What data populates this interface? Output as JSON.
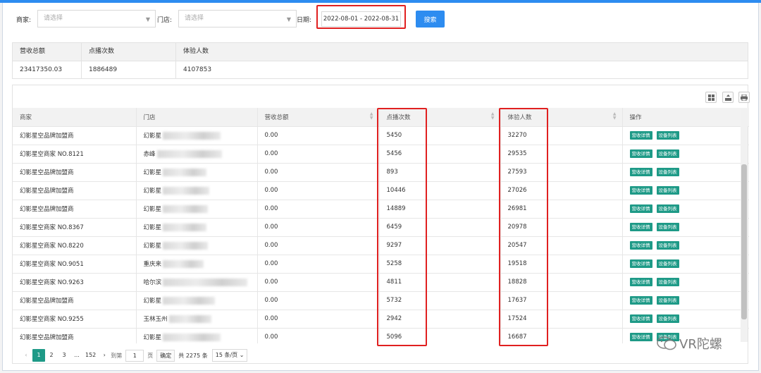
{
  "filters": {
    "merchant_label": "商家:",
    "merchant_placeholder": "请选择",
    "store_label": "门店:",
    "store_placeholder": "请选择",
    "date_label": "日期:",
    "date_value": "2022-08-01 - 2022-08-31",
    "search_label": "搜索"
  },
  "summary": {
    "headers": [
      "营收总额",
      "点播次数",
      "体验人数"
    ],
    "values": [
      "23417350.03",
      "1886489",
      "4107853"
    ]
  },
  "table": {
    "headers": [
      "商家",
      "门店",
      "营收总额",
      "点播次数",
      "体验人数",
      "操作"
    ],
    "op_revenue": "营收详情",
    "op_devices": "设备列表",
    "rows": [
      {
        "merchant": "幻影星空品牌加盟商",
        "store": "幻影星",
        "revenue": "0.00",
        "plays": "5450",
        "visitors": "32270"
      },
      {
        "merchant": "幻影星空商家 NO.8121",
        "store": "赤峰",
        "revenue": "0.00",
        "plays": "5456",
        "visitors": "29535"
      },
      {
        "merchant": "幻影星空品牌加盟商",
        "store": "幻影星",
        "revenue": "0.00",
        "plays": "893",
        "visitors": "27593"
      },
      {
        "merchant": "幻影星空品牌加盟商",
        "store": "幻影星",
        "revenue": "0.00",
        "plays": "10446",
        "visitors": "27026"
      },
      {
        "merchant": "幻影星空品牌加盟商",
        "store": "幻影星",
        "revenue": "0.00",
        "plays": "14889",
        "visitors": "26981"
      },
      {
        "merchant": "幻影星空商家 NO.8367",
        "store": "幻影星",
        "revenue": "0.00",
        "plays": "6459",
        "visitors": "20978"
      },
      {
        "merchant": "幻影星空商家 NO.8220",
        "store": "幻影星",
        "revenue": "0.00",
        "plays": "9297",
        "visitors": "20547"
      },
      {
        "merchant": "幻影星空商家 NO.9051",
        "store": "重庆来",
        "revenue": "0.00",
        "plays": "5258",
        "visitors": "19518"
      },
      {
        "merchant": "幻影星空商家 NO.9263",
        "store": "哈尔滨",
        "revenue": "0.00",
        "plays": "4811",
        "visitors": "18828"
      },
      {
        "merchant": "幻影星空品牌加盟商",
        "store": "幻影星",
        "revenue": "0.00",
        "plays": "5732",
        "visitors": "17637"
      },
      {
        "merchant": "幻影星空商家 NO.9255",
        "store": "玉林玉州",
        "revenue": "0.00",
        "plays": "2942",
        "visitors": "17524"
      },
      {
        "merchant": "幻影星空品牌加盟商",
        "store": "幻影星",
        "revenue": "0.00",
        "plays": "5096",
        "visitors": "16687"
      }
    ]
  },
  "pager": {
    "prev": "‹",
    "pages": [
      "1",
      "2",
      "3",
      "...",
      "152"
    ],
    "next": "›",
    "goto_label": "到第",
    "goto_value": "1",
    "page_unit": "页",
    "confirm": "确定",
    "total": "共 2275 条",
    "page_size": "15 条/页"
  },
  "watermark": "VR陀螺",
  "colors": {
    "accent_blue": "#2d8cf0",
    "op_green": "#1e9a87",
    "highlight_red": "#e02020"
  }
}
